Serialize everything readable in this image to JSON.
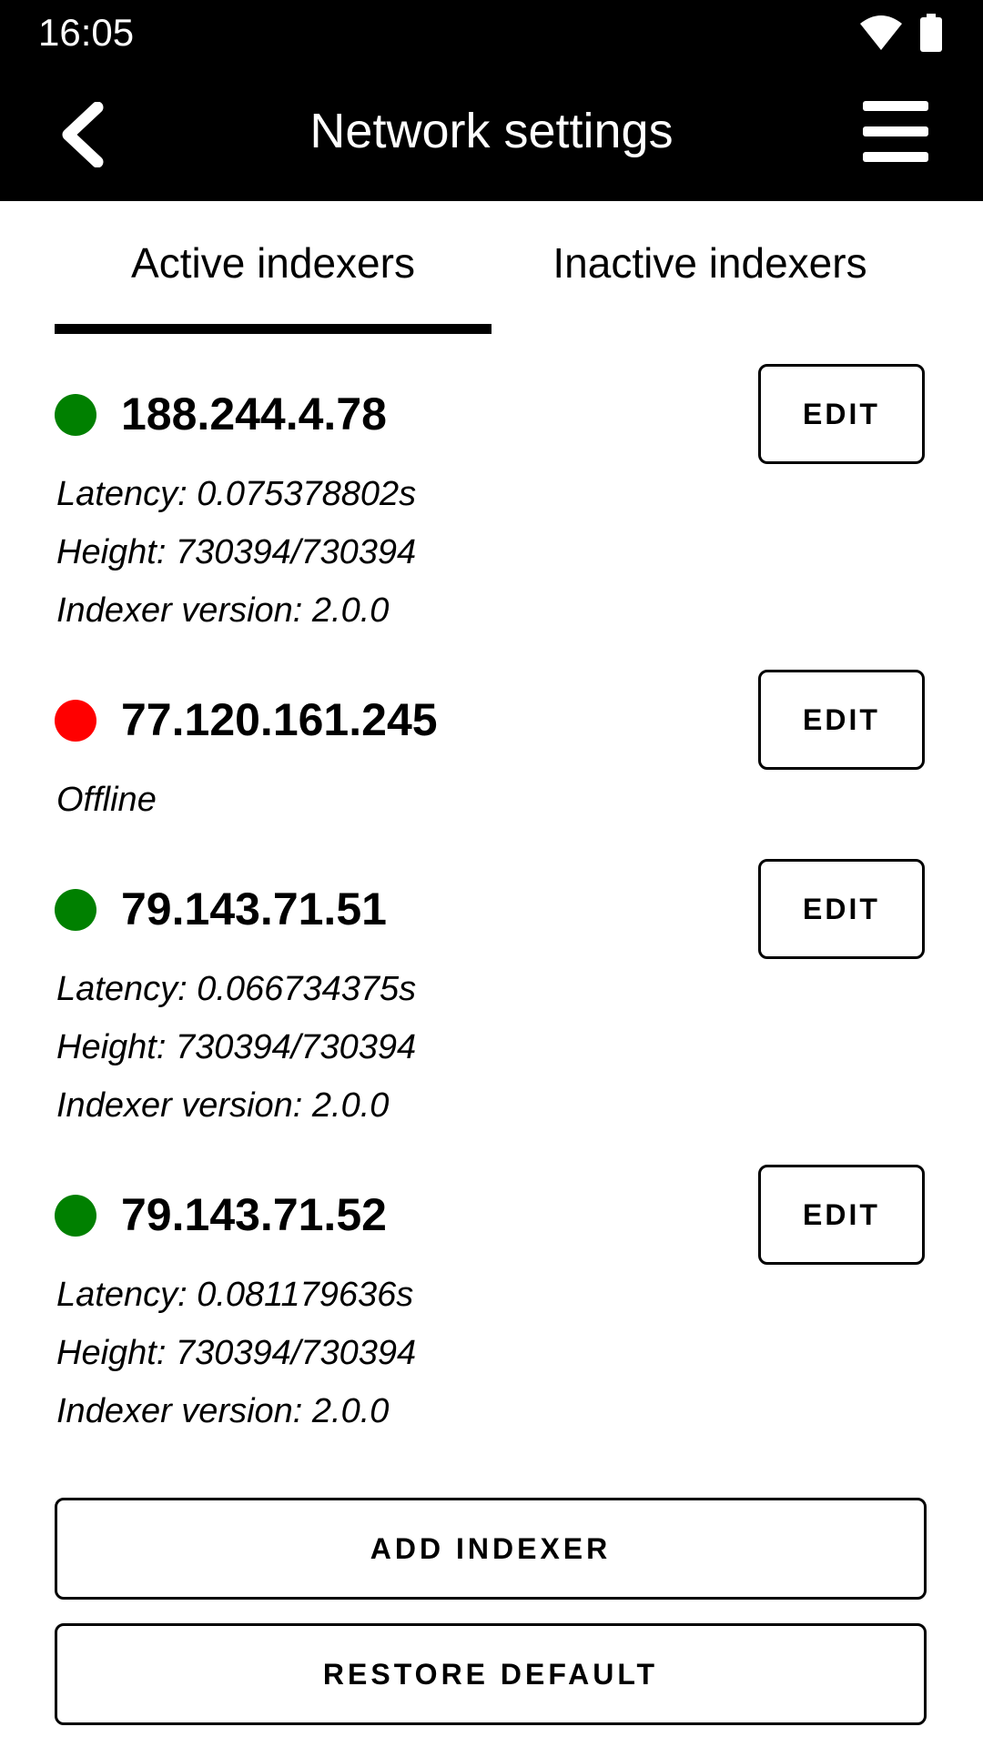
{
  "status": {
    "time": "16:05"
  },
  "header": {
    "title": "Network settings"
  },
  "tabs": [
    {
      "label": "Active indexers",
      "active": true
    },
    {
      "label": "Inactive indexers",
      "active": false
    }
  ],
  "indexers": [
    {
      "ip": "188.244.4.78",
      "status": "online",
      "color": "#008000",
      "latency": "Latency: 0.075378802s",
      "height": "Height: 730394/730394",
      "version": "Indexer version: 2.0.0",
      "edit": "EDIT"
    },
    {
      "ip": "77.120.161.245",
      "status": "offline",
      "color": "#ff0000",
      "offline": "Offline",
      "edit": "EDIT"
    },
    {
      "ip": "79.143.71.51",
      "status": "online",
      "color": "#008000",
      "latency": "Latency: 0.066734375s",
      "height": "Height: 730394/730394",
      "version": "Indexer version: 2.0.0",
      "edit": "EDIT"
    },
    {
      "ip": "79.143.71.52",
      "status": "online",
      "color": "#008000",
      "latency": "Latency: 0.081179636s",
      "height": "Height: 730394/730394",
      "version": "Indexer version: 2.0.0",
      "edit": "EDIT"
    }
  ],
  "actions": {
    "add": "ADD INDEXER",
    "restore": "RESTORE DEFAULT"
  },
  "icons": {
    "status": [
      "wifi-icon",
      "battery-icon"
    ],
    "back": "chevron-left-icon",
    "menu": "menu-icon"
  }
}
